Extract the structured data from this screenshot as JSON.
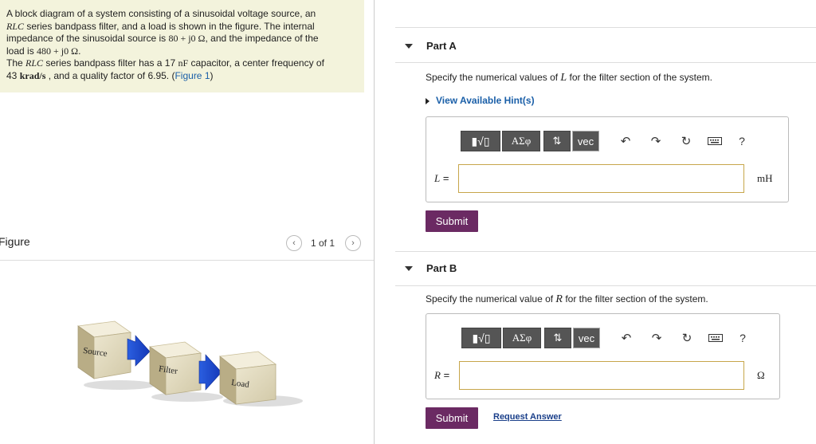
{
  "problem": {
    "line1": "A block diagram of a system consisting of a sinusoidal voltage source, an",
    "line2_var": "RLC",
    "line2_text": " series bandpass filter, and a load is shown in the figure. The internal",
    "line3_text": "impedance of the sinusoidal source is ",
    "line3_z": "80 + j0 Ω",
    "line3_tail": ", and the impedance of the",
    "line4_text": "load is ",
    "line4_z": "480 + j0 Ω",
    "line4_tail": ".",
    "line5_pre": " The ",
    "line5_var": "RLC",
    "line5_mid": " series bandpass filter has a 17 ",
    "line5_unit": "nF",
    "line5_tail": " capacitor, a center frequency of",
    "line6_val": "43 ",
    "line6_unit": "krad/s",
    "line6_tail": " , and a quality factor of 6.95. (",
    "line6_link": "Figure 1",
    "line6_end": ")"
  },
  "figure": {
    "label": "Figure",
    "count": "1 of 1",
    "blocks": {
      "source": "Source",
      "filter": "Filter",
      "load": "Load"
    }
  },
  "toolbar": {
    "templates_glyph": "▮√▯",
    "greek": "ΑΣφ",
    "arrows": "⇅",
    "vec": "vec",
    "help": "?"
  },
  "partA": {
    "title": "Part A",
    "prompt_pre": "Specify the numerical values of ",
    "prompt_var": "L",
    "prompt_post": " for the filter section of the system.",
    "hints": "View Available Hint(s)",
    "var": "L",
    "eq": " =",
    "value": "",
    "unit": "mH",
    "submit": "Submit"
  },
  "partB": {
    "title": "Part B",
    "prompt_pre": "Specify the numerical value of ",
    "prompt_var": "R",
    "prompt_post": " for the filter section of the system.",
    "var": "R",
    "eq": " =",
    "value": "",
    "unit": "Ω",
    "submit": "Submit",
    "request": "Request Answer"
  }
}
